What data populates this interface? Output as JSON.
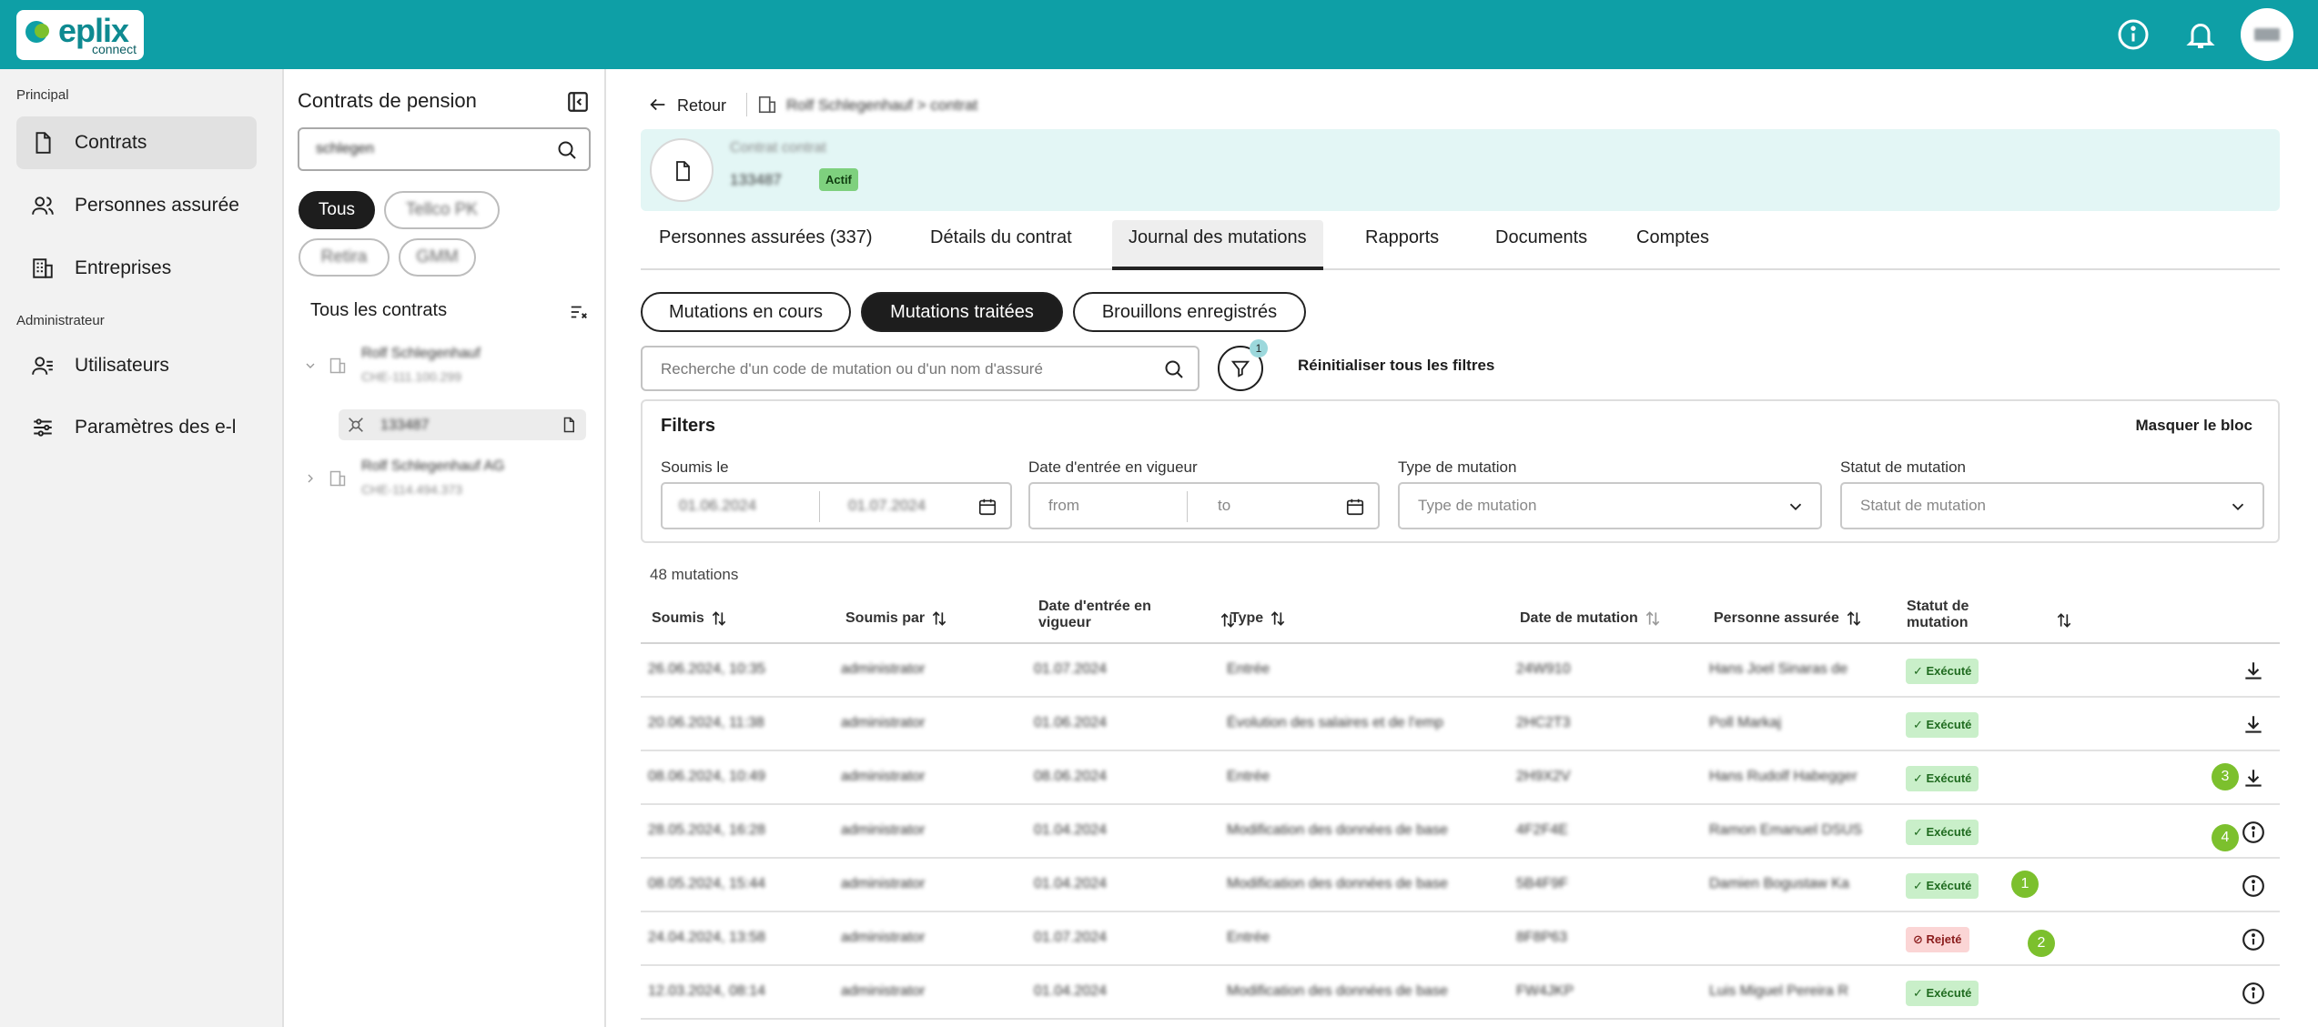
{
  "brand": {
    "name": "eplix",
    "sub": "connect"
  },
  "nav": {
    "section_principal": "Principal",
    "section_admin": "Administrateur",
    "items": [
      {
        "label": "Contrats",
        "icon": "document-icon"
      },
      {
        "label": "Personnes assurée",
        "icon": "users-icon"
      },
      {
        "label": "Entreprises",
        "icon": "building-icon"
      },
      {
        "label": "Utilisateurs",
        "icon": "user-admin-icon"
      },
      {
        "label": "Paramètres des e-l",
        "icon": "sliders-icon"
      }
    ]
  },
  "contracts_panel": {
    "title": "Contrats de pension",
    "search_value": "schlegen",
    "chips": [
      "Tous",
      "Tellco PK",
      "Retira",
      "GMM"
    ],
    "all_label": "Tous les contrats",
    "tree": [
      {
        "name": "Rolf Schlegenhauf",
        "code": "CHE-111.100.299"
      },
      {
        "contract": "133487"
      },
      {
        "name": "Rolf Schlegenhauf AG",
        "code": "CHE-114.494.373"
      }
    ]
  },
  "main": {
    "back_label": "Retour",
    "crumb": "Rolf Schlegenhauf > contrat",
    "header": {
      "line1": "Contrat contrat",
      "contract_no": "133487",
      "status": "Actif"
    },
    "tabs": [
      "Personnes assurées (337)",
      "Détails du contrat",
      "Journal des mutations",
      "Rapports",
      "Documents",
      "Comptes"
    ],
    "pills": [
      "Mutations en cours",
      "Mutations traitées",
      "Brouillons enregistrés"
    ],
    "search_placeholder": "Recherche d'un code de mutation ou d'un nom d'assuré",
    "filter_count": "1",
    "reset_label": "Réinitialiser tous les filtres",
    "filters": {
      "title": "Filters",
      "hide": "Masquer le bloc",
      "submitted_label": "Soumis le",
      "submitted_from": "01.06.2024",
      "submitted_to": "01.07.2024",
      "effective_label": "Date d'entrée en vigueur",
      "from_ph": "from",
      "to_ph": "to",
      "type_label": "Type de mutation",
      "type_ph": "Type de mutation",
      "status_label": "Statut de mutation",
      "status_ph": "Statut de mutation"
    },
    "count": "48 mutations",
    "columns": [
      "Soumis",
      "Soumis par",
      "Date d'entrée en vigueur",
      "Type",
      "Date de mutation",
      "Personne assurée",
      "Statut de mutation"
    ],
    "rows": [
      {
        "submitted": "26.06.2024, 10:35",
        "by": "administrator",
        "effective": "01.07.2024",
        "type": "Entrée",
        "date": "24W910",
        "person": "Hans Joel Sinaras de",
        "status": "Exécuté",
        "action": "download"
      },
      {
        "submitted": "20.06.2024, 11:38",
        "by": "administrator",
        "effective": "01.06.2024",
        "type": "Évolution des salaires et de l'emp",
        "date": "2HC2T3",
        "person": "Poll Markaj",
        "status": "Exécuté",
        "action": "download"
      },
      {
        "submitted": "08.06.2024, 10:49",
        "by": "administrator",
        "effective": "08.06.2024",
        "type": "Entrée",
        "date": "2H9X2V",
        "person": "Hans Rudolf Habegger",
        "status": "Exécuté",
        "action": "download",
        "marker": "3"
      },
      {
        "submitted": "28.05.2024, 16:28",
        "by": "administrator",
        "effective": "01.04.2024",
        "type": "Modification des données de base",
        "date": "4F2F4E",
        "person": "Ramon Emanuel DSUS",
        "status": "Exécuté",
        "action": "info",
        "marker": "4"
      },
      {
        "submitted": "08.05.2024, 15:44",
        "by": "administrator",
        "effective": "01.04.2024",
        "type": "Modification des données de base",
        "date": "5B4F9F",
        "person": "Damien Bogustaw Ka",
        "status": "Exécuté",
        "action": "info",
        "status_marker": "1"
      },
      {
        "submitted": "24.04.2024, 13:58",
        "by": "administrator",
        "effective": "01.07.2024",
        "type": "Entrée",
        "date": "8F8P63",
        "person": "",
        "status": "Rejeté",
        "action": "info",
        "status_marker": "2"
      },
      {
        "submitted": "12.03.2024, 08:14",
        "by": "administrator",
        "effective": "01.04.2024",
        "type": "Modification des données de base",
        "date": "FW4JKP",
        "person": "Luis Miguel Pereira R",
        "status": "Exécuté",
        "action": "info"
      }
    ]
  },
  "colors": {
    "brand": "#0e9fa6",
    "header_card": "#e3f6f5",
    "marker": "#7cc02d",
    "ok_badge": "#c9efc9",
    "rejected_badge": "#fbd5d5"
  }
}
